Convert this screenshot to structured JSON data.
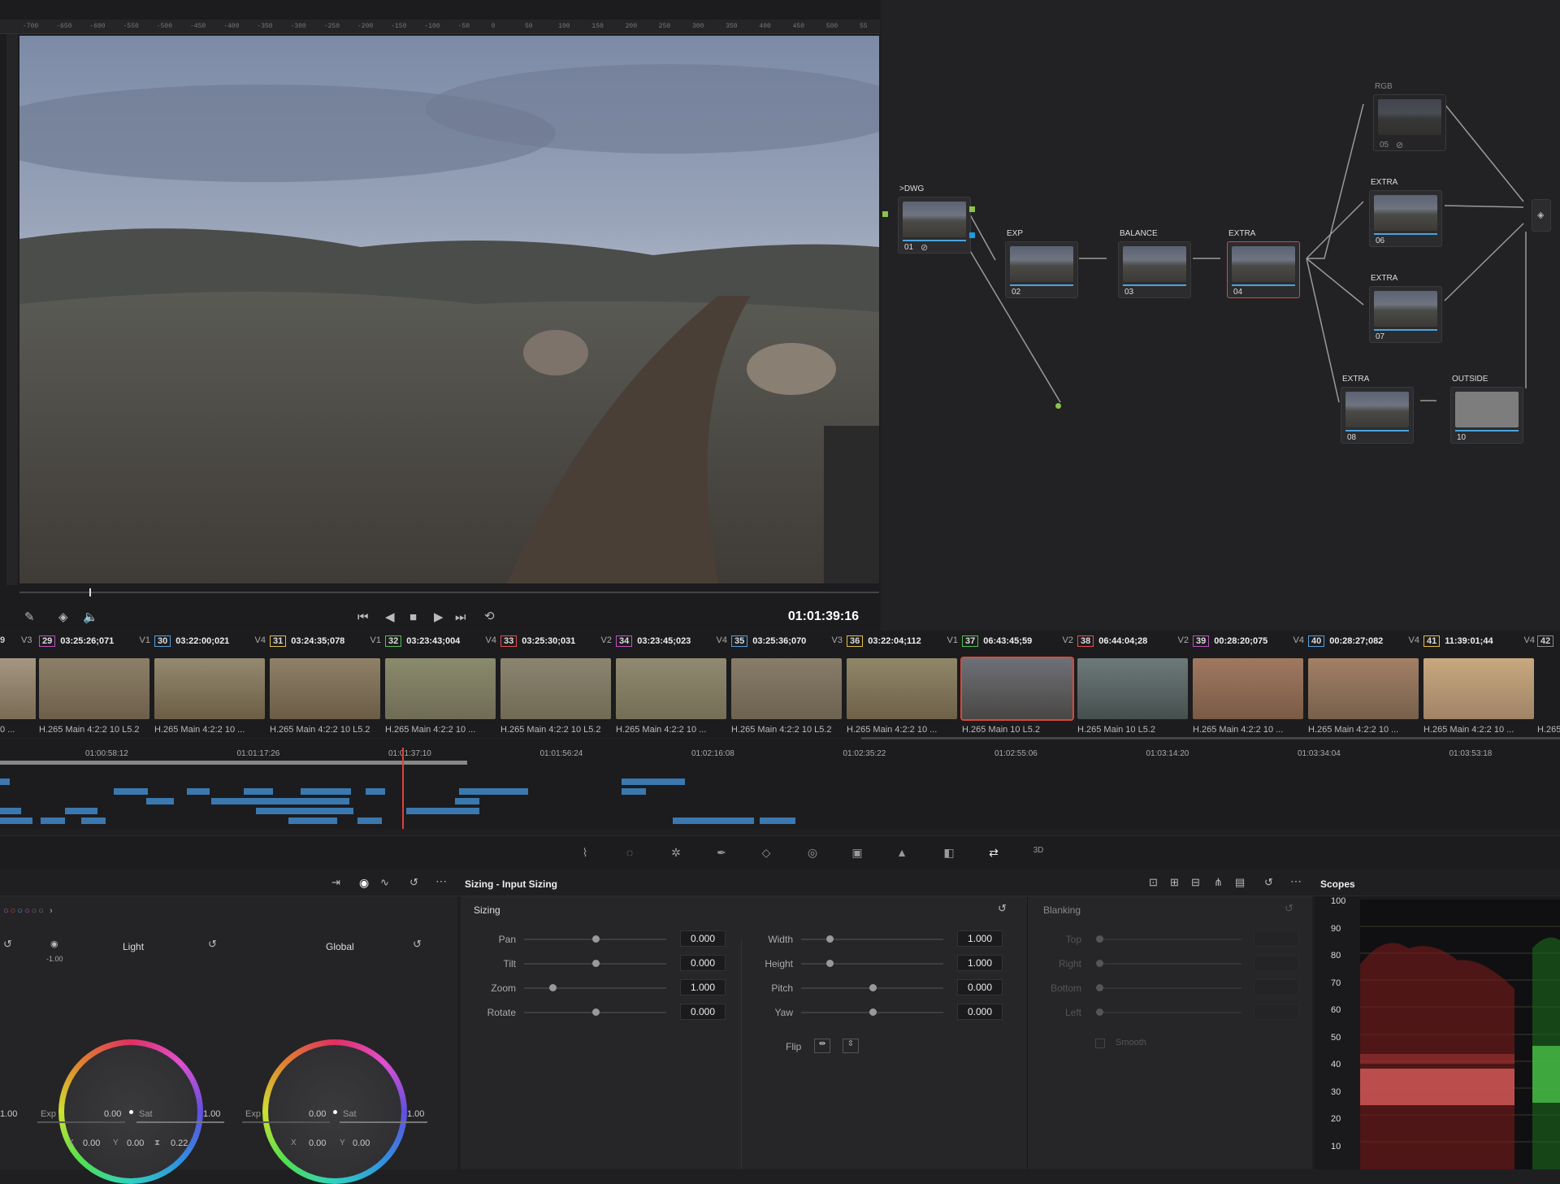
{
  "viewer": {
    "ruler_ticks": [
      "-700",
      "-650",
      "-600",
      "-550",
      "-500",
      "-450",
      "-400",
      "-350",
      "-300",
      "-250",
      "-200",
      "-150",
      "-100",
      "-50",
      "0",
      "50",
      "100",
      "150",
      "200",
      "250",
      "300",
      "350",
      "400",
      "450",
      "500",
      "55"
    ],
    "timecode": "01:01:39:16"
  },
  "nodes": [
    {
      "label": ">DWG",
      "num": "01",
      "icon": "disable-icon"
    },
    {
      "label": "EXP",
      "num": "02"
    },
    {
      "label": "BALANCE",
      "num": "03"
    },
    {
      "label": "EXTRA",
      "num": "04"
    },
    {
      "label": "RGB",
      "num": "05",
      "icon": "disable-icon"
    },
    {
      "label": "EXTRA",
      "num": "06"
    },
    {
      "label": "EXTRA",
      "num": "07"
    },
    {
      "label": "EXTRA",
      "num": "08"
    },
    {
      "label": "OUTSIDE",
      "num": "10"
    }
  ],
  "clips": [
    {
      "num": "29",
      "tc": "03:25:26;071",
      "trk": "V1",
      "codec": "H.265 Main 4:2:2 10 L5.2"
    },
    {
      "num": "30",
      "tc": "03:22:00;021",
      "trk": "V4",
      "codec": "H.265 Main 4:2:2 10 ..."
    },
    {
      "num": "31",
      "tc": "03:24:35;078",
      "trk": "V1",
      "codec": "H.265 Main 4:2:2 10 L5.2"
    },
    {
      "num": "32",
      "tc": "03:23:43;004",
      "trk": "V4",
      "codec": "H.265 Main 4:2:2 10 ..."
    },
    {
      "num": "33",
      "tc": "03:25:30;031",
      "trk": "V2",
      "codec": "H.265 Main 4:2:2 10 L5.2"
    },
    {
      "num": "34",
      "tc": "03:23:45;023",
      "trk": "V4",
      "codec": "H.265 Main 4:2:2 10 ..."
    },
    {
      "num": "35",
      "tc": "03:25:36;070",
      "trk": "V3",
      "codec": "H.265 Main 4:2:2 10 L5.2"
    },
    {
      "num": "36",
      "tc": "03:22:04;112",
      "trk": "V1",
      "codec": "H.265 Main 4:2:2 10 ..."
    },
    {
      "num": "37",
      "tc": "06:43:45;59",
      "trk": "V2",
      "codec": "H.265 Main 10 L5.2"
    },
    {
      "num": "38",
      "tc": "06:44:04;28",
      "trk": "V2",
      "codec": "H.265 Main 10 L5.2"
    },
    {
      "num": "39",
      "tc": "00:28:20;075",
      "trk": "V4",
      "codec": "H.265 Main 4:2:2 10 ..."
    },
    {
      "num": "40",
      "tc": "00:28:27;082",
      "trk": "V4",
      "codec": "H.265 Main 4:2:2 10 ..."
    },
    {
      "num": "41",
      "tc": "11:39:01;44",
      "trk": "V4",
      "codec": "H.265 Main 4:2:2 10 ..."
    }
  ],
  "clip_edge": {
    "left_num": "9",
    "left_trk": "V3",
    "left_codec": "0 ...",
    "right_num": "42",
    "right_codec": "H.265"
  },
  "mini_timeline": {
    "labels": [
      "01:00:58:12",
      "01:01:17:26",
      "01:01:37:10",
      "01:01:56:24",
      "01:02:16:08",
      "01:02:35:22",
      "01:02:55:06",
      "01:03:14:20",
      "01:03:34:04",
      "01:03:53:18"
    ]
  },
  "color_panel": {
    "light_label": "Light",
    "global_label": "Global",
    "light_value": "-1.00",
    "left_edge_value": "1.00",
    "light_exp_label": "Exp",
    "light_exp": "0.00",
    "light_sat_label": "Sat",
    "light_sat": "1.00",
    "global_exp_label": "Exp",
    "global_exp": "0.00",
    "global_sat_label": "Sat",
    "global_sat": "1.00",
    "light_x": "0.00",
    "light_y": "0.00",
    "light_extra": "0.22",
    "global_x": "0.00",
    "global_y": "0.00",
    "x_label": "X",
    "y_label": "Y"
  },
  "sizing": {
    "title": "Sizing - Input Sizing",
    "section": "Sizing",
    "left_rows": [
      {
        "label": "Pan",
        "value": "0.000",
        "pos": 0.5
      },
      {
        "label": "Tilt",
        "value": "0.000",
        "pos": 0.5
      },
      {
        "label": "Zoom",
        "value": "1.000",
        "pos": 0.2
      },
      {
        "label": "Rotate",
        "value": "0.000",
        "pos": 0.5
      }
    ],
    "right_rows": [
      {
        "label": "Width",
        "value": "1.000",
        "pos": 0.2
      },
      {
        "label": "Height",
        "value": "1.000",
        "pos": 0.2
      },
      {
        "label": "Pitch",
        "value": "0.000",
        "pos": 0.5
      },
      {
        "label": "Yaw",
        "value": "0.000",
        "pos": 0.5
      }
    ],
    "flip_label": "Flip",
    "blanking": "Blanking",
    "blanking_rows": [
      "Top",
      "Right",
      "Bottom",
      "Left"
    ],
    "smooth": "Smooth"
  },
  "scopes": {
    "title": "Scopes",
    "scale": [
      "100",
      "90",
      "80",
      "70",
      "60",
      "50",
      "40",
      "30",
      "20",
      "10"
    ]
  },
  "colors": {
    "accent_blue": "#1e9be0",
    "node_green": "#8bc34a",
    "playhead": "#e04040",
    "selected": "#d9483b"
  }
}
